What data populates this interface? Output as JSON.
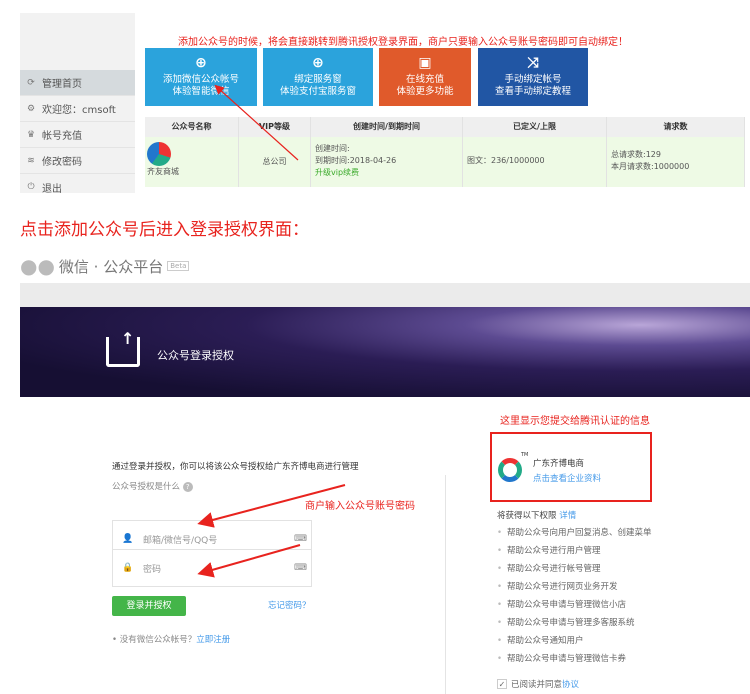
{
  "sidebar": {
    "items": [
      {
        "label": "管理首页",
        "icon": "refresh-icon"
      },
      {
        "label": "欢迎您：cmsoft",
        "icon": "users-icon"
      },
      {
        "label": "帐号充值",
        "icon": "coins-icon"
      },
      {
        "label": "修改密码",
        "icon": "rss-icon"
      },
      {
        "label": "退出",
        "icon": "power-icon"
      }
    ]
  },
  "top_note": "添加公众号的时候，将会直接跳转到腾讯授权登录界面，商户只要输入公众号账号密码即可自动绑定！",
  "tiles": [
    {
      "line1": "添加微信公众帐号",
      "line2": "体验智能微信",
      "icon": "plus-icon",
      "color": "#2ba3dc"
    },
    {
      "line1": "绑定服务窗",
      "line2": "体验支付宝服务窗",
      "icon": "plus-icon",
      "color": "#2ba3dc"
    },
    {
      "line1": "在线充值",
      "line2": "体验更多功能",
      "icon": "money-icon",
      "color": "#e05a2b"
    },
    {
      "line1": "手动绑定帐号",
      "line2": "查看手动绑定教程",
      "icon": "shuffle-icon",
      "color": "#2156a4"
    }
  ],
  "table": {
    "headers": [
      "公众号名称",
      "VIP等级",
      "创建时间/到期时间",
      "已定义/上限",
      "请求数"
    ],
    "row": {
      "name": "齐友商城",
      "vip": "总公司",
      "created": "创建时间:",
      "expires": "到期时间:2018-04-26",
      "upgrade": "升级vip续费",
      "defined": "图文：236/1000000",
      "total_requests": "总请求数:129",
      "month_requests": "本月请求数:1000000"
    }
  },
  "section_title": "点击添加公众号后进入登录授权界面：",
  "wechat": {
    "brand": "微信 · 公众平台",
    "beta": "Beta"
  },
  "banner": {
    "title": "公众号登录授权"
  },
  "login": {
    "intro": "通过登录并授权，你可以将该公众号授权给广东齐博电商进行管理",
    "what": "公众号授权是什么",
    "account_placeholder": "邮箱/微信号/QQ号",
    "password_placeholder": "密码",
    "submit": "登录并授权",
    "forgot": "忘记密码？",
    "no_account": "没有微信公众帐号？",
    "register": "立即注册"
  },
  "annotations": {
    "input_note": "商户输入公众号账号密码",
    "info_note": "这里显示您提交给腾讯认证的信息"
  },
  "company": {
    "tm": "TM",
    "name": "广东齐博电商",
    "link": "点击查看企业资料"
  },
  "permissions": {
    "title": "将获得以下权限",
    "detail": "详情",
    "items": [
      "帮助公众号向用户回复消息、创建菜单",
      "帮助公众号进行用户管理",
      "帮助公众号进行帐号管理",
      "帮助公众号进行网页业务开发",
      "帮助公众号申请与管理微信小店",
      "帮助公众号申请与管理多客服系统",
      "帮助公众号通知用户",
      "帮助公众号申请与管理微信卡券"
    ]
  },
  "agree": {
    "text": "已阅读并同意",
    "link": "协议",
    "checked": true
  }
}
